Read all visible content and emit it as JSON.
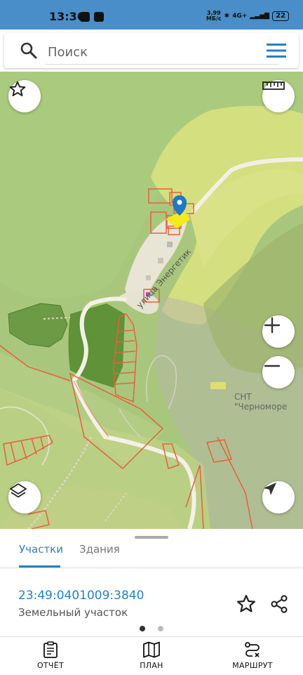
{
  "status": {
    "time": "13:36",
    "speed_value": "3,99",
    "speed_unit": "МБ/с",
    "network": "4G+",
    "battery": "22"
  },
  "search": {
    "placeholder": "Поиск"
  },
  "map": {
    "street_label": "улица Энергетик",
    "area_label": "СНТ \"Черноморе"
  },
  "tabs": [
    {
      "label": "Участки",
      "active": true
    },
    {
      "label": "Здания",
      "active": false
    }
  ],
  "parcel": {
    "cadastral_number": "23:49:0401009:3840",
    "type": "Земельный участок"
  },
  "pager": {
    "count": 2,
    "active": 0
  },
  "bottom_nav": {
    "report": "ОТЧЁТ",
    "plan": "ПЛАН",
    "route": "МАРШРУТ"
  },
  "colors": {
    "accent": "#2a7fc0",
    "status_bar": "#4a8ec9",
    "parcel_border": "#e8603c",
    "selected_parcel": "#f4ea1e",
    "marker": "#1f78c8"
  },
  "icons": {
    "search": "search-icon",
    "menu": "menu-icon",
    "favorite": "star-icon",
    "ruler": "ruler-icon",
    "zoom_in": "plus-icon",
    "zoom_out": "minus-icon",
    "layers": "layers-icon",
    "locate": "navigation-arrow-icon",
    "share": "share-icon",
    "report": "clipboard-icon",
    "plan": "map-icon",
    "route": "route-icon"
  }
}
